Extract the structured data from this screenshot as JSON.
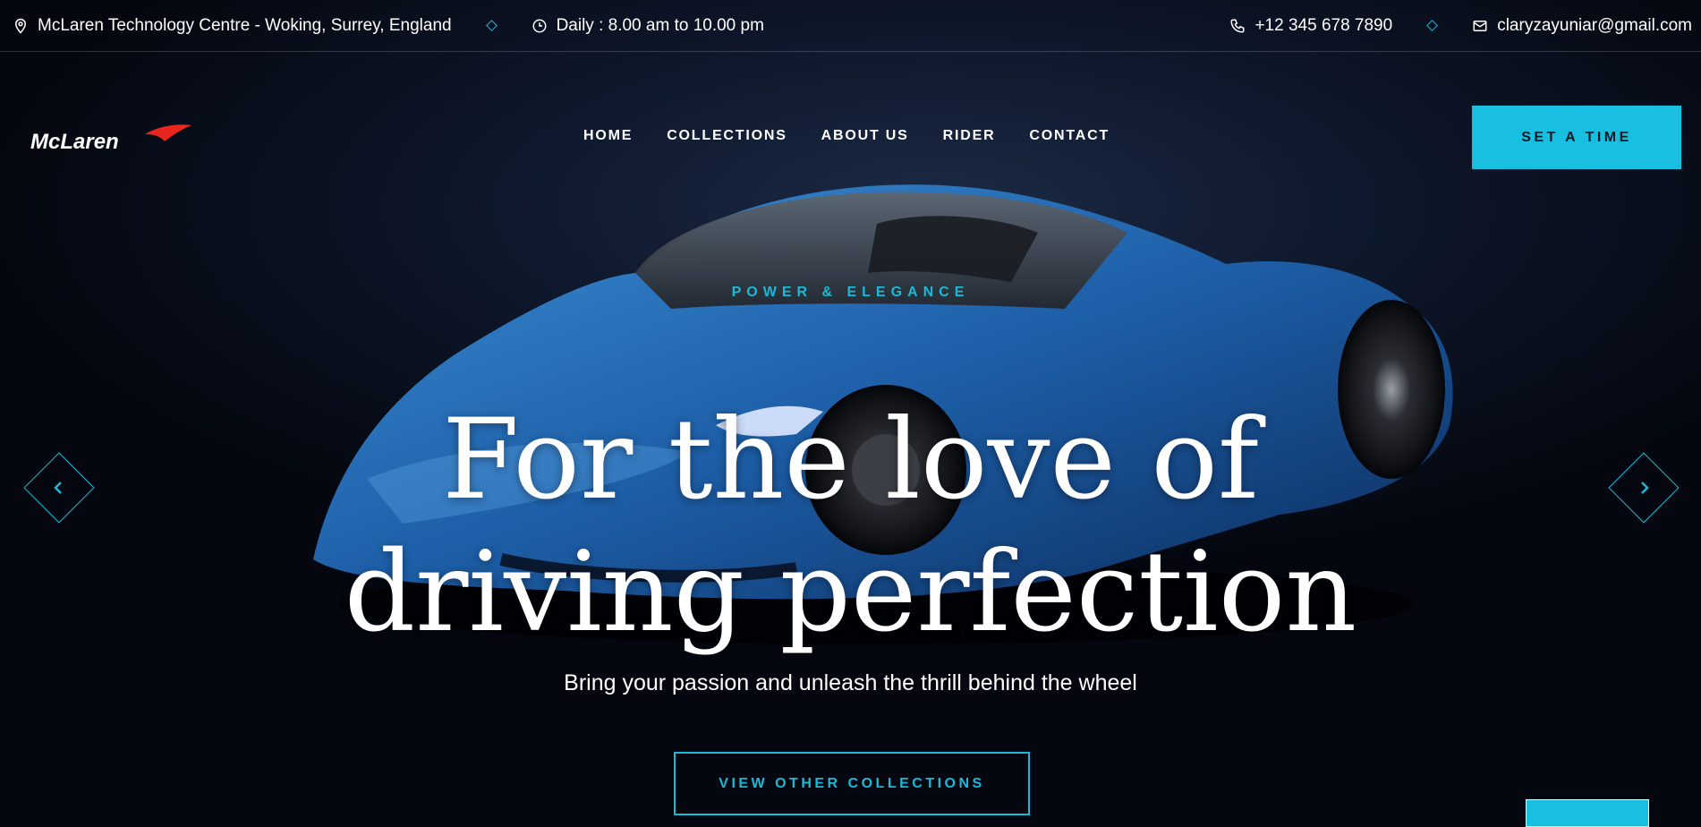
{
  "topbar": {
    "address": "McLaren Technology Centre - Woking, Surrey, England",
    "hours": "Daily : 8.00 am to 10.00 pm",
    "phone": "+12 345 678 7890",
    "email": "claryzayuniar@gmail.com"
  },
  "brand": {
    "logo_text": "McLaren"
  },
  "nav": {
    "items": [
      "HOME",
      "COLLECTIONS",
      "ABOUT US",
      "RIDER",
      "CONTACT"
    ],
    "cta_label": "SET A TIME"
  },
  "hero": {
    "eyebrow": "POWER & ELEGANCE",
    "headline_line1": "For the love of",
    "headline_line2": "driving perfection",
    "subline": "Bring your passion and unleash the thrill behind the wheel",
    "button_label": "VIEW OTHER COLLECTIONS"
  },
  "colors": {
    "accent": "#19b9d8",
    "background": "#03060d",
    "logo_swoosh": "#e8261d"
  },
  "icons": {
    "address": "map-pin-icon",
    "hours": "clock-icon",
    "phone": "phone-icon",
    "email": "mail-icon",
    "prev": "chevron-left-icon",
    "next": "chevron-right-icon"
  }
}
